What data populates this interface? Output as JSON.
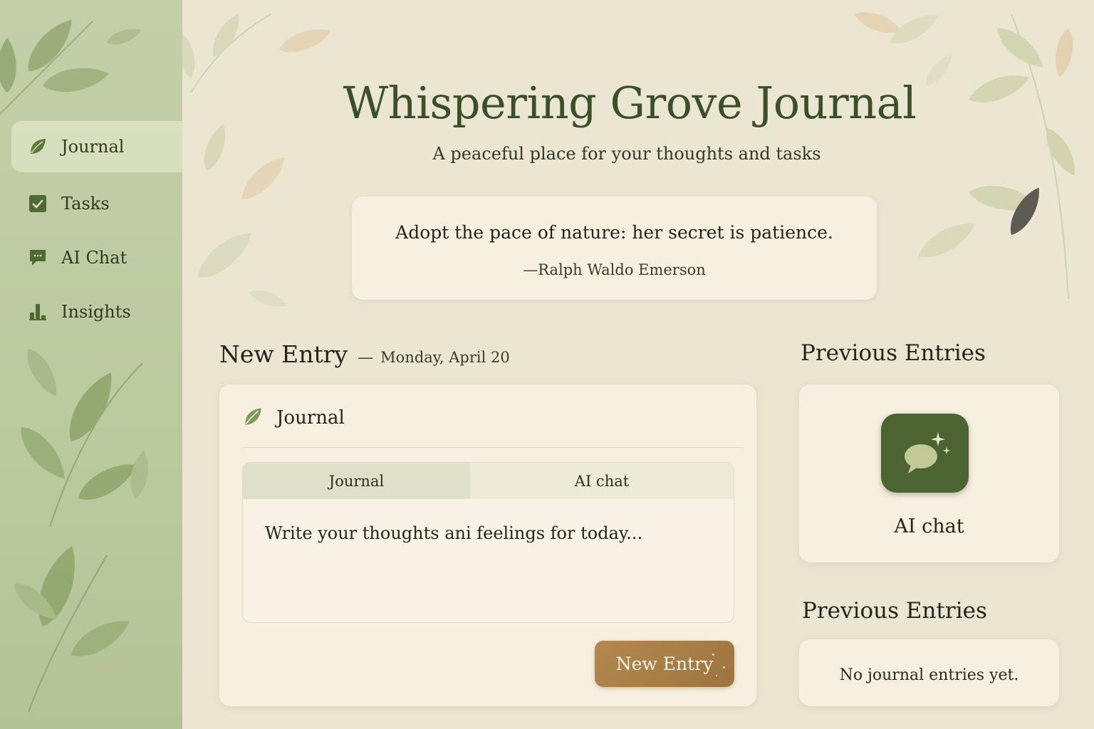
{
  "sidebar": {
    "items": [
      {
        "label": "Journal",
        "icon": "leaf-icon",
        "active": true
      },
      {
        "label": "Tasks",
        "icon": "checkbox-icon"
      },
      {
        "label": "AI Chat",
        "icon": "chat-icon"
      },
      {
        "label": "Insights",
        "icon": "bar-chart-icon"
      }
    ]
  },
  "header": {
    "title": "Whispering Grove Journal",
    "subtitle": "A peaceful place for your thoughts and tasks"
  },
  "quote": {
    "text": "Adopt the pace of nature: her secret is patience.",
    "author": "—Ralph Waldo Emerson"
  },
  "new_entry": {
    "title": "New Entry",
    "dash": "—",
    "date": "Monday, April 20",
    "card_label": "Journal",
    "tabs": [
      "Journal",
      "AI chat"
    ],
    "placeholder": "Write your thoughts ani feelings for today...",
    "button_label": "New Entry"
  },
  "previous": {
    "title_1": "Previous Entries",
    "app_label": "AI chat",
    "app_icon": "chat-sparkle-icon",
    "title_2": "Previous Entries",
    "empty_text": "No journal entries yet."
  },
  "colors": {
    "background": "#ebe6d2",
    "sidebar": "#bccaa0",
    "accent_green": "#4c6332",
    "title_green": "#3c4f29",
    "button_brown": "#a77c45",
    "card": "#f7f0e1"
  }
}
